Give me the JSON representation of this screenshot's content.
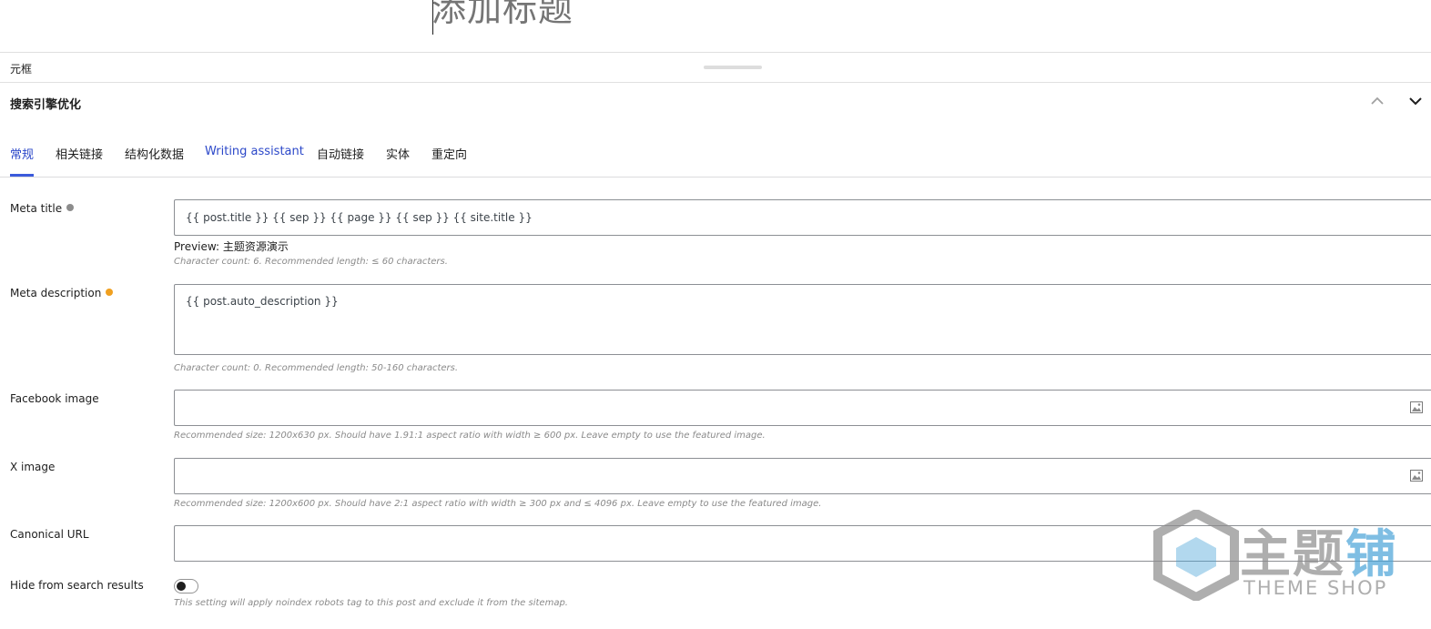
{
  "editor": {
    "title_placeholder": "添加标题"
  },
  "metabox": {
    "label": "元框"
  },
  "panel": {
    "title": "搜索引擎优化"
  },
  "tabs": [
    {
      "label": "常规"
    },
    {
      "label": "相关链接"
    },
    {
      "label": "结构化数据"
    },
    {
      "label": "Writing assistant"
    },
    {
      "label": "自动链接"
    },
    {
      "label": "实体"
    },
    {
      "label": "重定向"
    }
  ],
  "fields": {
    "meta_title": {
      "label": "Meta title",
      "value": "{{ post.title }} {{ sep }} {{ page }} {{ sep }} {{ site.title }}",
      "preview": "Preview: 主题资源演示",
      "hint": "Character count: 6. Recommended length: ≤ 60 characters.",
      "status_color": "#8c8c8c"
    },
    "meta_description": {
      "label": "Meta description",
      "value": "{{ post.auto_description }}",
      "hint": "Character count: 0. Recommended length: 50-160 characters.",
      "status_color": "#f0a020"
    },
    "facebook_image": {
      "label": "Facebook image",
      "value": "",
      "hint": "Recommended size: 1200x630 px. Should have 1.91:1 aspect ratio with width ≥ 600 px. Leave empty to use the featured image."
    },
    "x_image": {
      "label": "X image",
      "value": "",
      "hint": "Recommended size: 1200x600 px. Should have 2:1 aspect ratio with width ≥ 300 px and ≤ 4096 px. Leave empty to use the featured image."
    },
    "canonical_url": {
      "label": "Canonical URL",
      "value": ""
    },
    "hide_from_search": {
      "label": "Hide from search results",
      "enabled": false,
      "hint": "This setting will apply noindex robots tag to this post and exclude it from the sitemap."
    }
  },
  "watermark": {
    "cn_main": "主题",
    "cn_accent": "铺",
    "en": "THEME SHOP"
  },
  "colors": {
    "accent": "#2c48c9",
    "tab_underline": "#3b5bdb"
  }
}
